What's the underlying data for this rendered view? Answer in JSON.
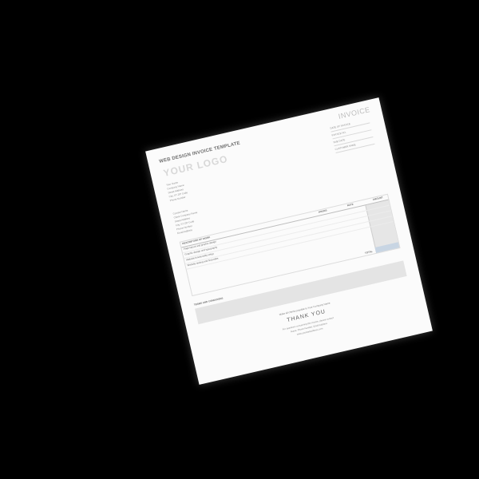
{
  "document": {
    "title": "WEB DESIGN INVOICE TEMPLATE",
    "logo": "YOUR LOGO",
    "invoice_label": "INVOICE",
    "meta": [
      "DATE OF INVOICE",
      "INVOICE NO.",
      "DUE DATE",
      "CUSTOMER NAME"
    ],
    "sender_lines": [
      "Your Name",
      "Company Name",
      "Street Address",
      "City, ST ZIP Code",
      "Phone Number"
    ],
    "bill_to_lines": [
      "Contact Name",
      "Client Company Name",
      "Street Address",
      "City, ST ZIP Code",
      "Phone Number",
      "Email Address"
    ],
    "table": {
      "headers": {
        "description": "DESCRIPTION OF WORK",
        "hours": "HOURS",
        "rate": "RATE",
        "amount": "AMOUNT"
      },
      "rows": [
        "Page layout and graphic design",
        "Graphic design and typography",
        "Website functionality setup",
        "Website testing and final edits"
      ],
      "total_label": "TOTAL"
    },
    "terms_title": "TERMS AND CONDITIONS",
    "footer_note": "Make all checks payable to Your Company Name",
    "thank_you": "THANK YOU",
    "contact_line1": "For questions concerning this invoice, please contact",
    "contact_line2": "Name, Phone Number, Email Address",
    "contact_line3": "www.yourwebaddress.com"
  }
}
